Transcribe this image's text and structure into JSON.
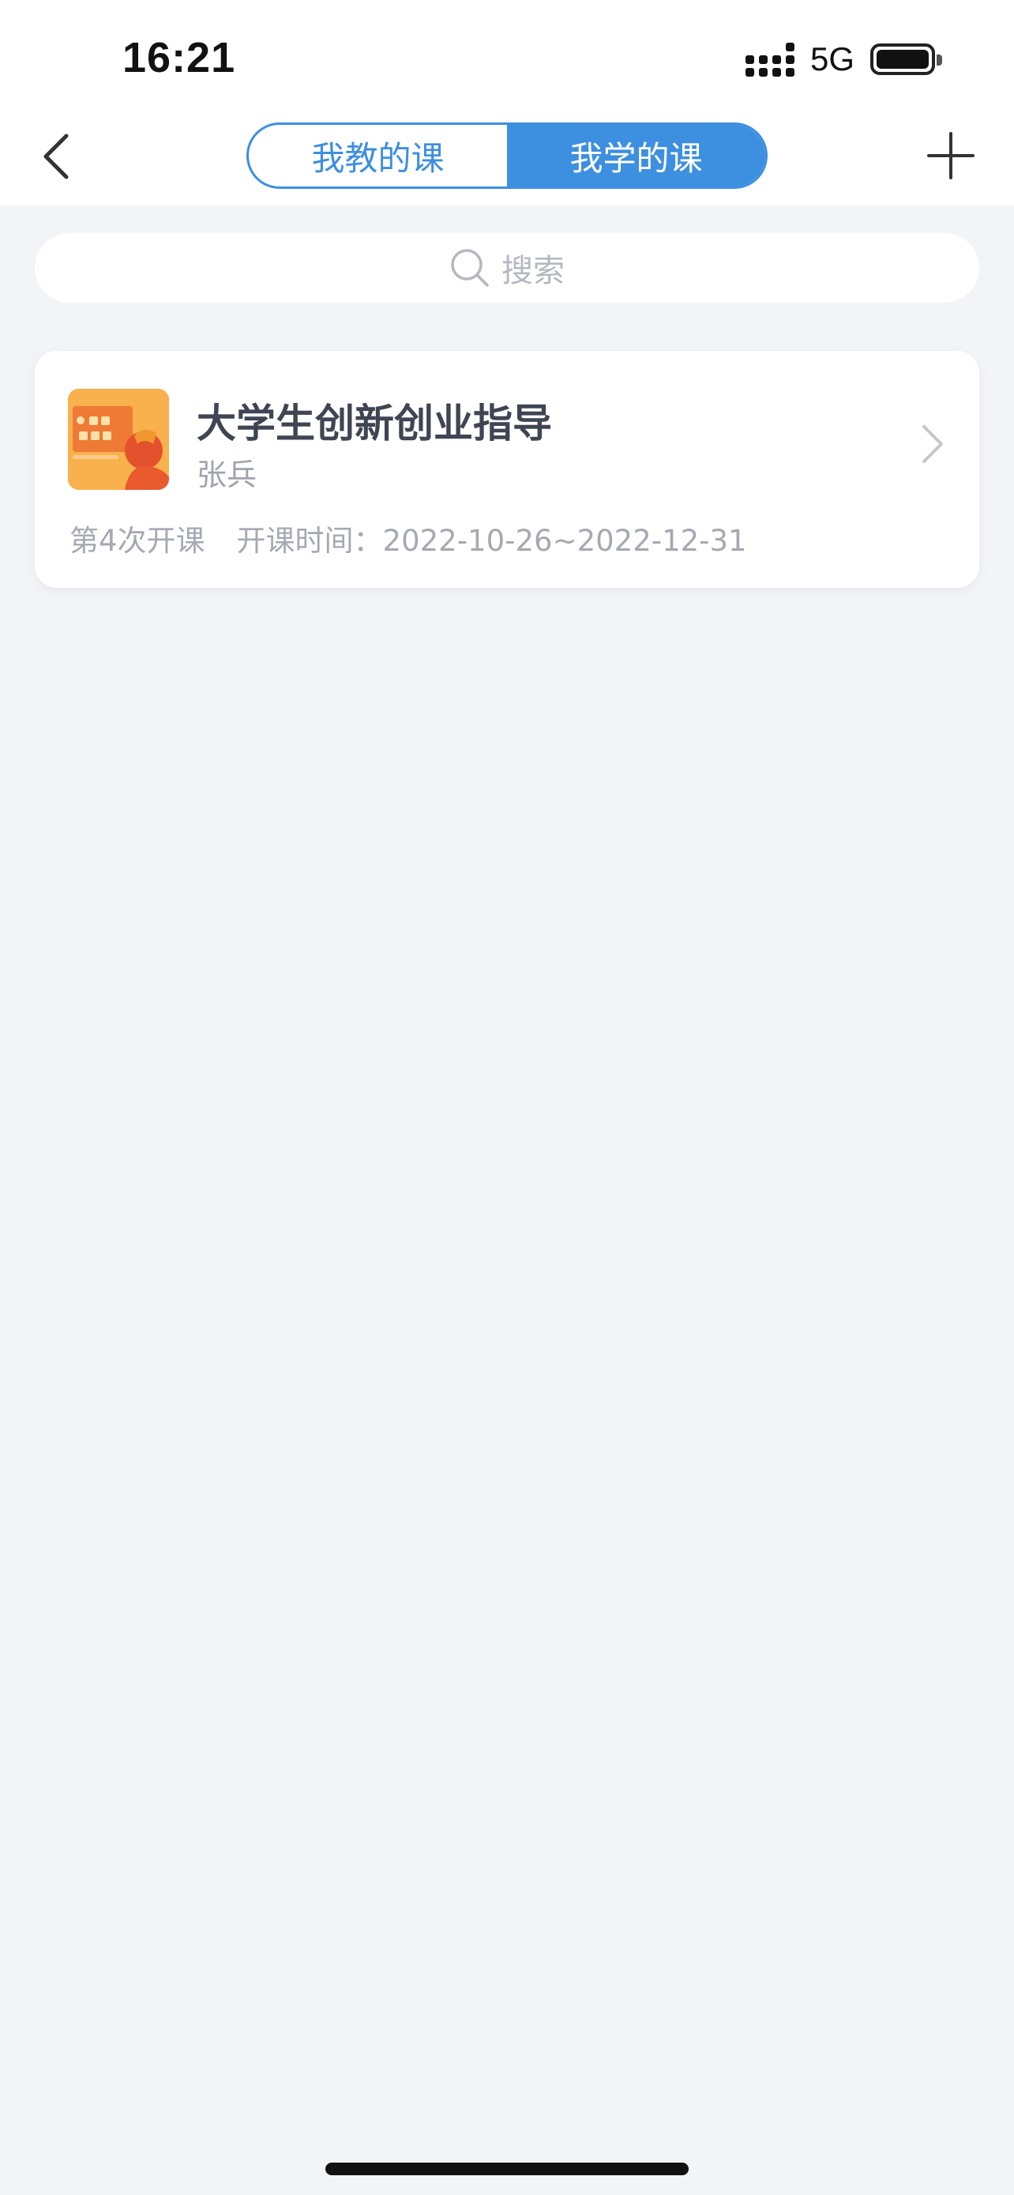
{
  "status_bar": {
    "time": "16:21",
    "network": "5G"
  },
  "nav": {
    "tabs": [
      {
        "label": "我教的课",
        "active": false
      },
      {
        "label": "我学的课",
        "active": true
      }
    ]
  },
  "search": {
    "placeholder": "搜索"
  },
  "courses": [
    {
      "title": "大学生创新创业指导",
      "teacher": "张兵",
      "session": "第4次开课",
      "schedule": "开课时间：2022-10-26~2022-12-31"
    }
  ],
  "colors": {
    "accent": "#3d8fe0",
    "background": "#f2f4f7"
  }
}
